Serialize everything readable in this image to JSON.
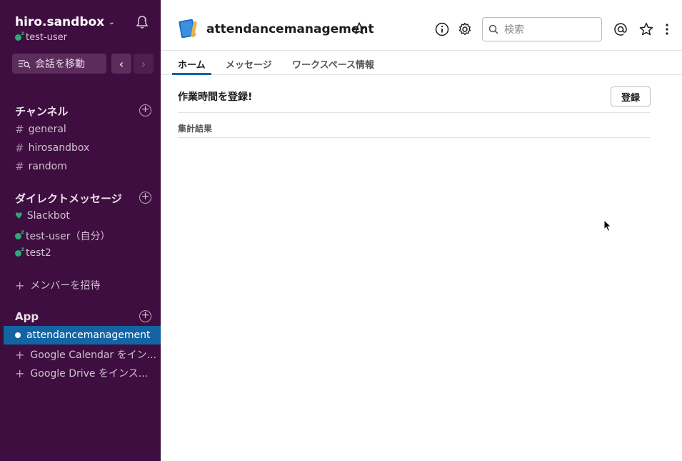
{
  "sidebar": {
    "workspace_name": "hiro.sandbox",
    "current_user": "test-user",
    "jump_label": "会話を移動",
    "channels_header": "チャンネル",
    "channels": [
      "general",
      "hirosandbox",
      "random"
    ],
    "dm_header": "ダイレクトメッセージ",
    "dms": [
      {
        "name": "Slackbot",
        "icon": "heart-icon"
      },
      {
        "name": "test-user（自分）",
        "icon": "presence-icon"
      },
      {
        "name": "test2",
        "icon": "presence-icon"
      }
    ],
    "invite_label": "メンバーを招待",
    "apps_header": "App",
    "apps": [
      {
        "name": "attendancemanagement",
        "active": true
      },
      {
        "name": "Google Calendar をイン...",
        "active": false
      },
      {
        "name": "Google Drive をインス...",
        "active": false
      }
    ]
  },
  "header": {
    "app_title": "attendancemanagement",
    "search_placeholder": "検索"
  },
  "tabs": [
    "ホーム",
    "メッセージ",
    "ワークスペース情報"
  ],
  "home": {
    "title": "作業時間を登録!",
    "register_button": "登録",
    "results_label": "集計結果"
  },
  "colors": {
    "sidebar_bg": "#3f0e40",
    "active_item": "#1264a3",
    "presence": "#2bac76"
  }
}
